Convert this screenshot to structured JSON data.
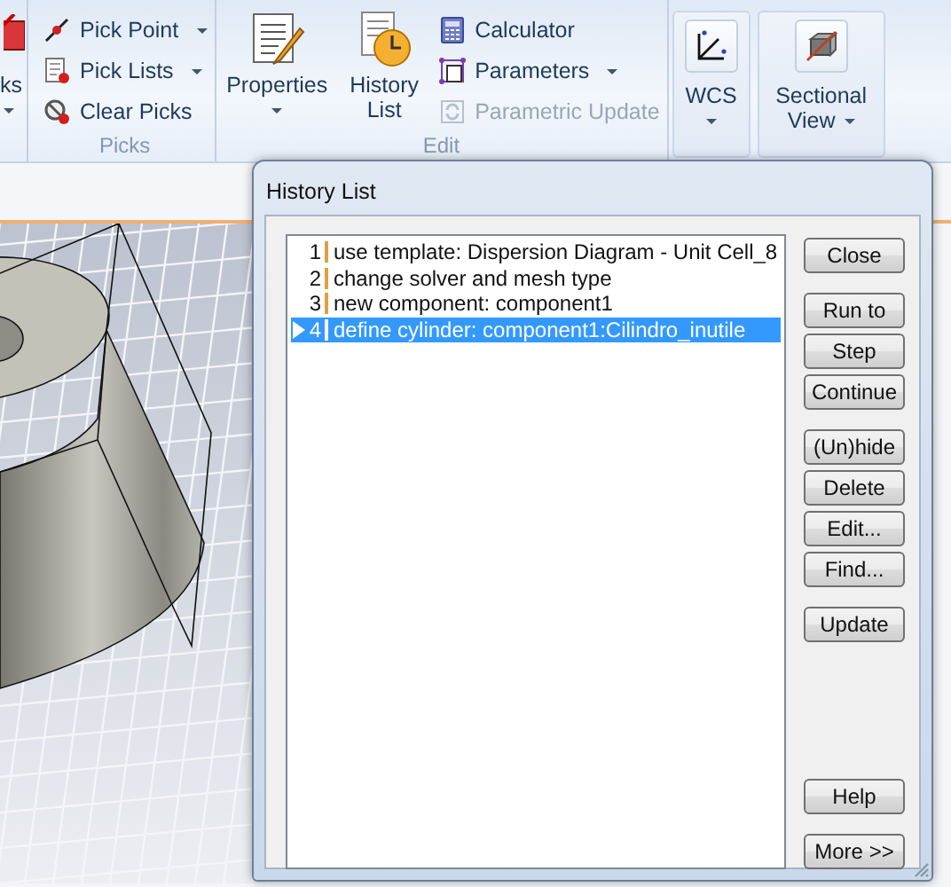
{
  "ribbon": {
    "groups": [
      {
        "kind": "partial",
        "items": [
          {
            "kind": "large",
            "label": "ks",
            "dropdown": true,
            "disabled": false
          }
        ]
      },
      {
        "kind": "group",
        "label": "Picks",
        "items": [
          {
            "kind": "small",
            "label": "Pick Point",
            "dropdown": true,
            "disabled": false
          },
          {
            "kind": "small",
            "label": "Pick Lists",
            "dropdown": true,
            "disabled": false
          },
          {
            "kind": "small",
            "label": "Clear Picks",
            "dropdown": false,
            "disabled": false
          }
        ]
      },
      {
        "kind": "group",
        "label": "Edit",
        "items": [
          {
            "kind": "large",
            "label": "Properties",
            "dropdown": true,
            "disabled": false
          },
          {
            "kind": "large",
            "label": "History List",
            "dropdown": false,
            "disabled": false
          },
          {
            "kind": "small",
            "label": "Calculator",
            "dropdown": false,
            "disabled": false
          },
          {
            "kind": "small",
            "label": "Parameters",
            "dropdown": true,
            "disabled": false
          },
          {
            "kind": "small",
            "label": "Parametric Update",
            "dropdown": false,
            "disabled": true
          }
        ]
      },
      {
        "kind": "panel",
        "items": [
          {
            "kind": "boxed",
            "label": "WCS",
            "dropdown": true,
            "disabled": false
          }
        ]
      },
      {
        "kind": "panel",
        "items": [
          {
            "kind": "boxed",
            "label": "Sectional View",
            "dropdown": true,
            "disabled": false
          }
        ]
      }
    ]
  },
  "dialog": {
    "title": "History List",
    "entries": [
      {
        "number": "1",
        "text": "use template: Dispersion Diagram - Unit Cell_8",
        "selected": false,
        "current": false
      },
      {
        "number": "2",
        "text": "change solver and mesh type",
        "selected": false,
        "current": false
      },
      {
        "number": "3",
        "text": "new component: component1",
        "selected": false,
        "current": false
      },
      {
        "number": "4",
        "text": "define cylinder: component1:Cilindro_inutile",
        "selected": true,
        "current": true
      }
    ],
    "button_groups": [
      [
        "Close"
      ],
      [
        "Run to",
        "Step",
        "Continue"
      ],
      [
        "(Un)hide",
        "Delete",
        "Edit...",
        "Find..."
      ],
      [
        "Update"
      ]
    ],
    "bottom_buttons": [
      "Help",
      "More >>"
    ]
  }
}
